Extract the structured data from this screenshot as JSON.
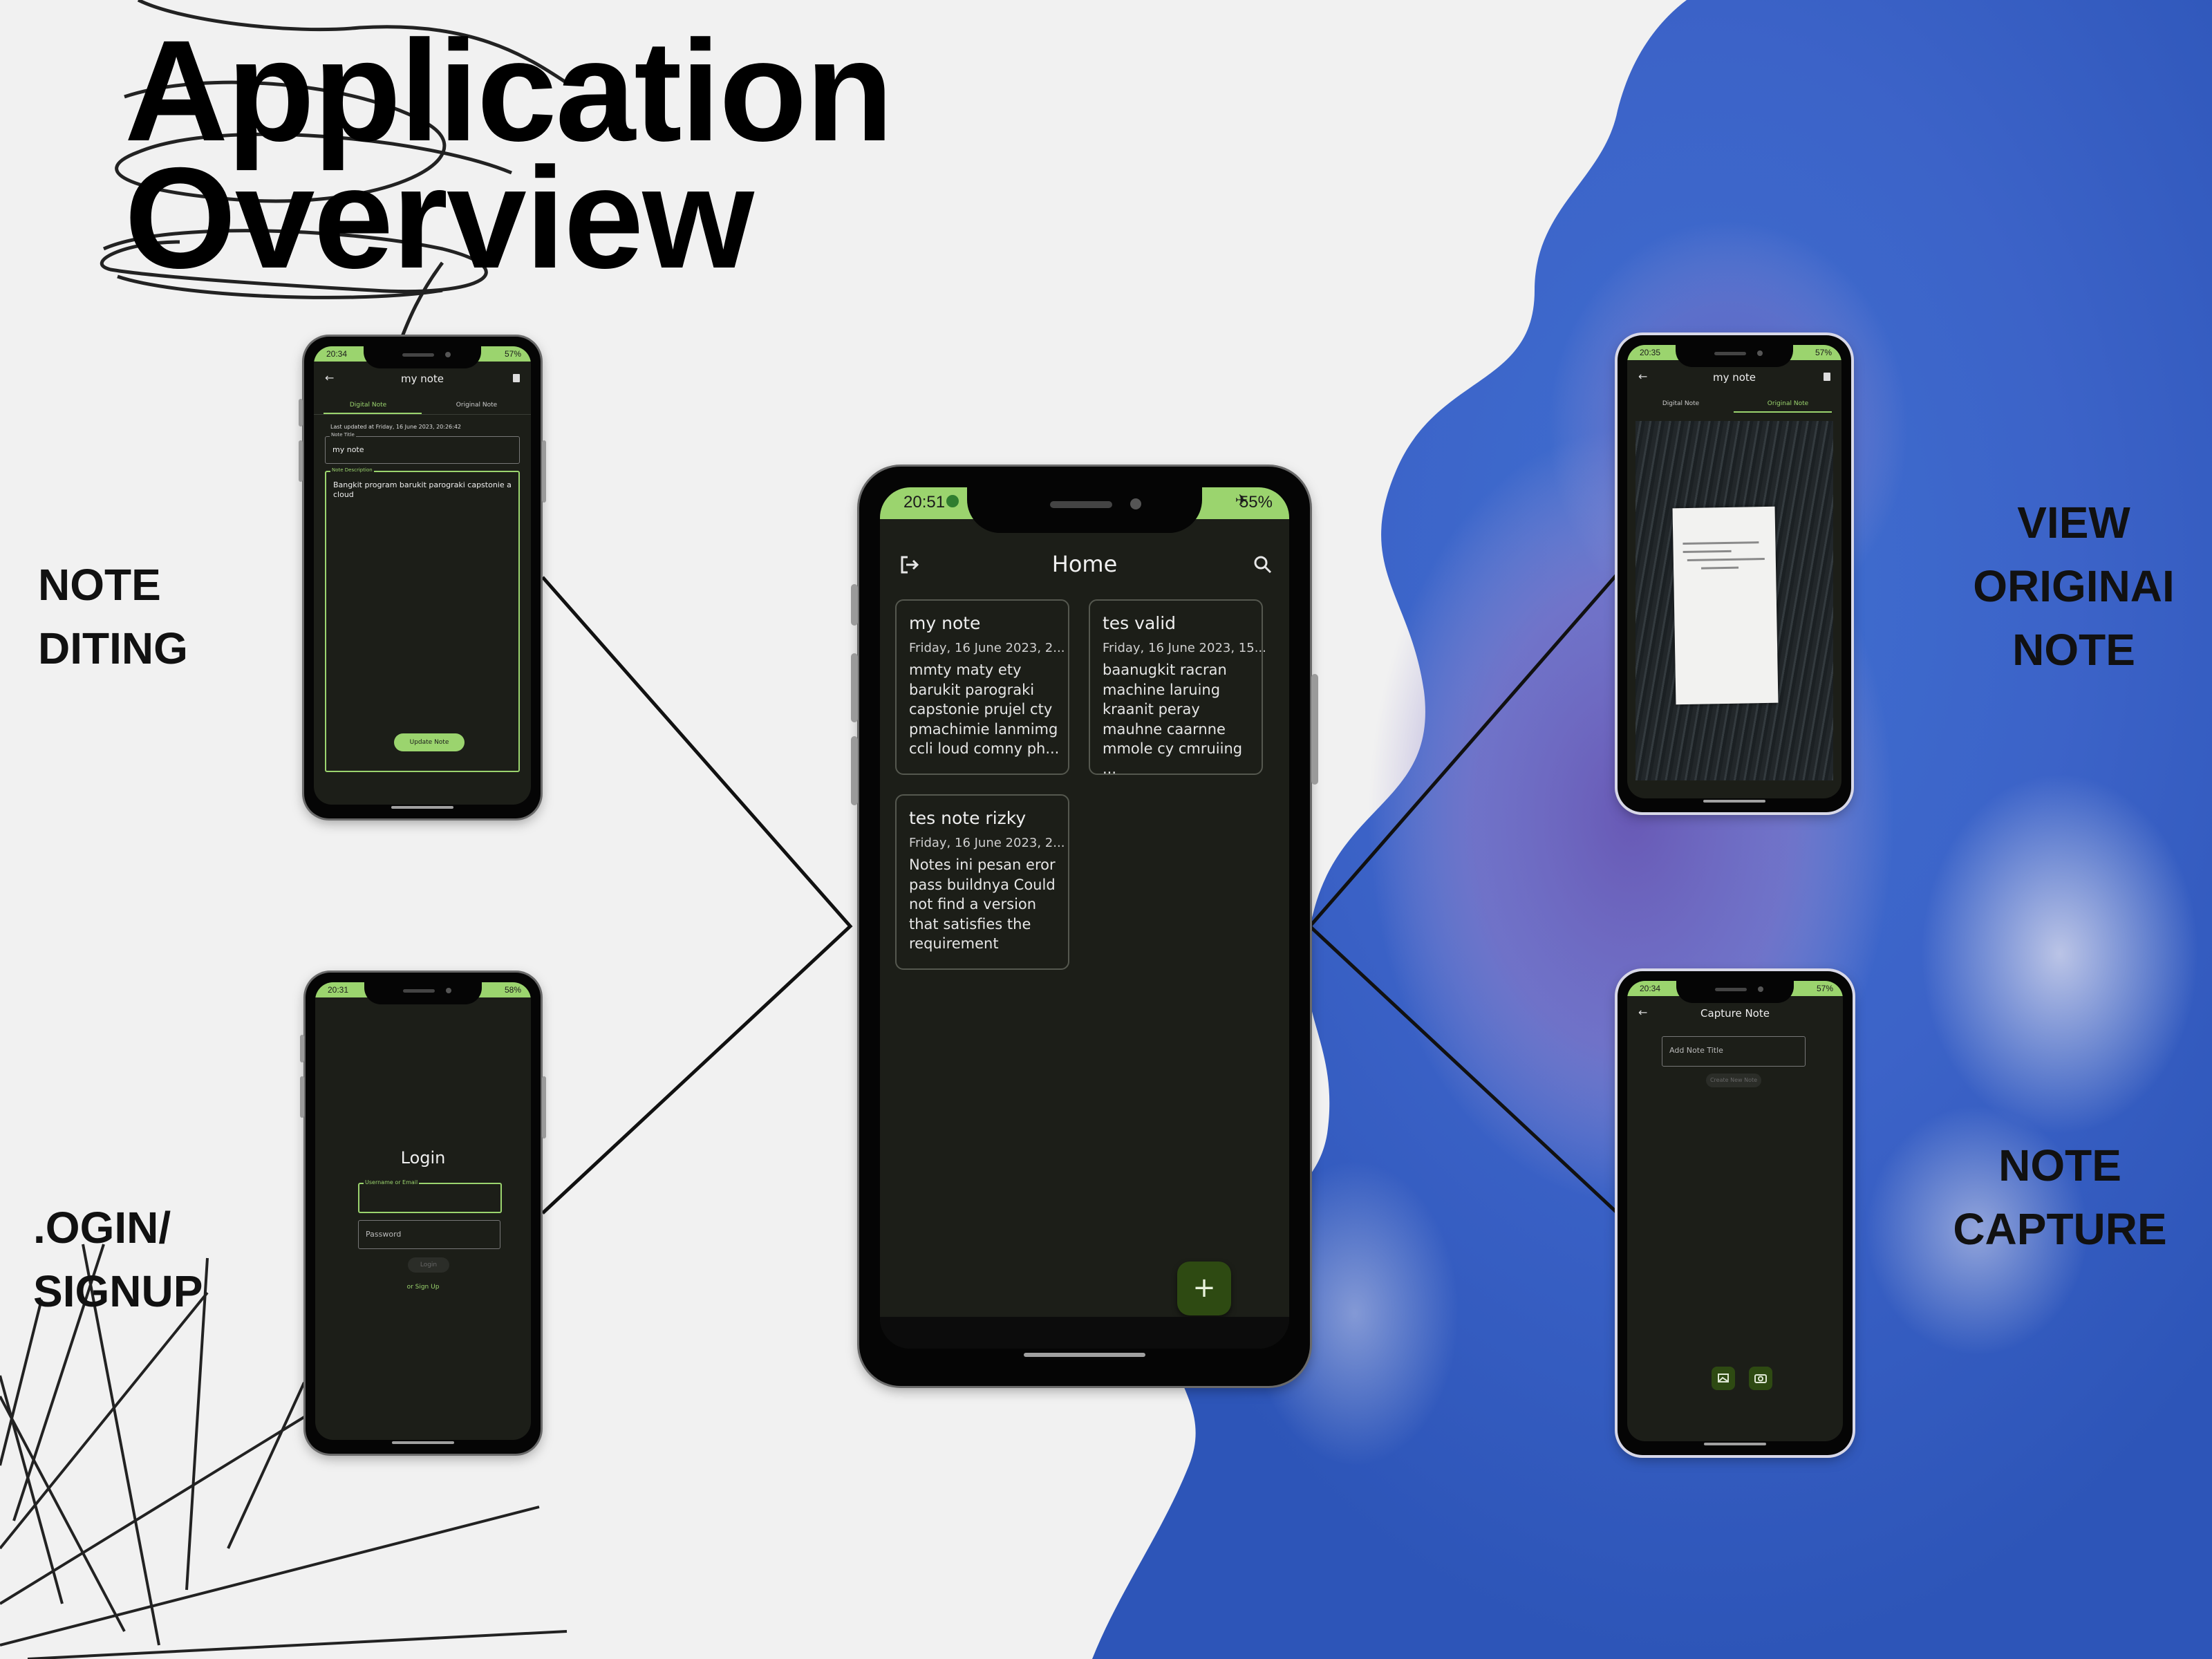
{
  "slide": {
    "title_line1": "Application",
    "title_line2": "Overview",
    "labels": {
      "note_editing": [
        "NOTE",
        "DITING"
      ],
      "login_signup": [
        ".OGIN/",
        "SIGNUP"
      ],
      "view_original": [
        "VIEW",
        "ORIGINAI",
        "NOTE"
      ],
      "note_capture": [
        "NOTE",
        "CAPTURE"
      ]
    }
  },
  "home_screen": {
    "status": {
      "time": "20:51",
      "battery": "55%"
    },
    "title": "Home",
    "notes": [
      {
        "title": "my note",
        "date": "Friday, 16 June 2023, 2...",
        "body": "mmty maty ety barukit parograki capstonie prujel cty pmachimie lanmimg ccli loud comny ph..."
      },
      {
        "title": "tes valid",
        "date": "Friday, 16 June 2023, 15...",
        "body": "baanugkit racran machine laruing kraanit peray mauhne caarnne mmole cy cmruiing ..."
      },
      {
        "title": "tes note rizky",
        "date": "Friday, 16 June 2023, 2...",
        "body": "Notes ini pesan eror pass buildnya Could not find a version that satisfies the requirement"
      }
    ],
    "fab": "+"
  },
  "edit_screen": {
    "status": {
      "time": "20:34",
      "battery": "57%"
    },
    "title": "my note",
    "tabs": [
      "Digital Note",
      "Original Note"
    ],
    "last_updated": "Last updated at Friday, 16 June 2023, 20:26:42",
    "note_title_label": "Note Title",
    "note_title_value": "my note",
    "note_desc_label": "Note Description",
    "note_desc_value": "Bangkit program barukit parograki capstonie a cloud",
    "update_button": "Update Note"
  },
  "login_screen": {
    "status": {
      "time": "20:31",
      "battery": "58%"
    },
    "title": "Login",
    "username_label": "Username or Email",
    "password_placeholder": "Password",
    "login_button": "Login",
    "signup_link": "or Sign Up"
  },
  "original_screen": {
    "status": {
      "time": "20:35",
      "battery": "57%"
    },
    "title": "my note",
    "tabs": [
      "Digital Note",
      "Original Note"
    ]
  },
  "capture_screen": {
    "status": {
      "time": "20:34",
      "battery": "57%"
    },
    "title": "Capture Note",
    "title_placeholder": "Add Note Title",
    "create_button": "Create New Note"
  },
  "colors": {
    "accent_green": "#9bd46e",
    "fab_green": "#2e4a12",
    "screen_bg": "#1c1e18",
    "card_border": "#55584f"
  }
}
